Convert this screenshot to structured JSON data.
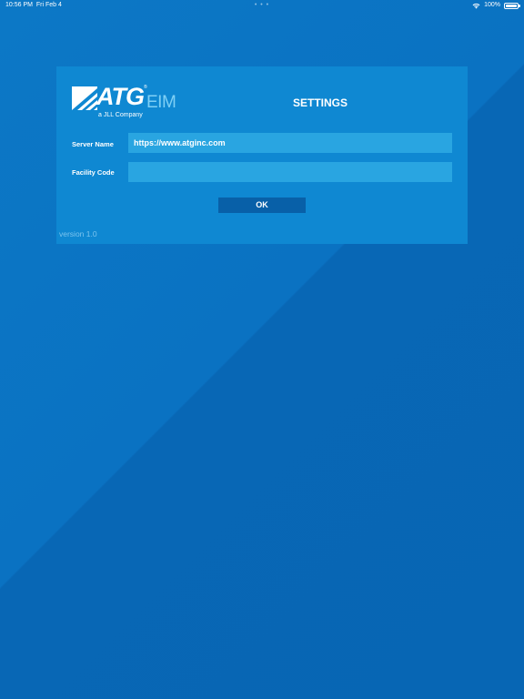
{
  "status_bar": {
    "time": "10:56 PM",
    "date": "Fri Feb 4",
    "dots": "• • •",
    "battery": "100%",
    "wifi_icon": "wifi-icon",
    "battery_icon": "battery-icon"
  },
  "logo": {
    "brand": "ATG",
    "registered": "®",
    "product": "EIM",
    "tagline": "a JLL Company",
    "mark_icon": "atg-stripes-logo"
  },
  "settings": {
    "title": "SETTINGS",
    "server_name_label": "Server Name",
    "server_name_value": "https://www.atginc.com",
    "facility_code_label": "Facility Code",
    "facility_code_value": "",
    "ok_label": "OK",
    "version": "version 1.0"
  },
  "colors": {
    "background": "#0a6fc0",
    "panel": "#0f88d2",
    "input": "#29a5e1",
    "button": "#0860a8",
    "logo_accent": "#7fd0f5"
  }
}
